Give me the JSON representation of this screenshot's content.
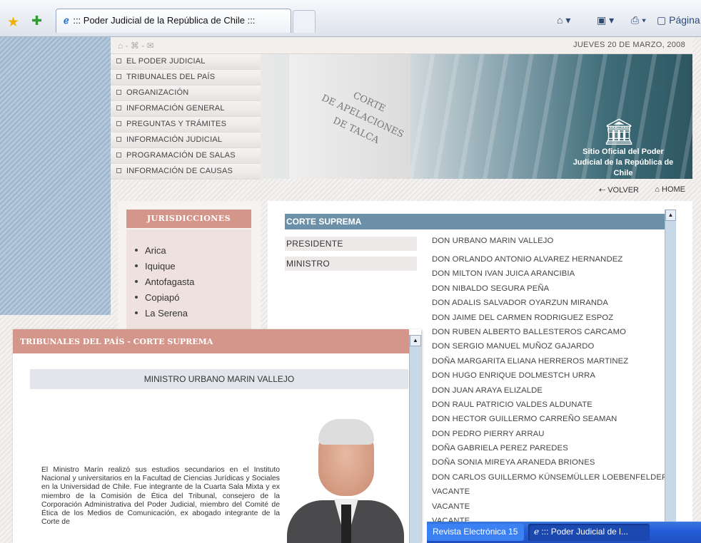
{
  "browser": {
    "tab_title": "::: Poder Judicial de la República de Chile :::",
    "tab_icon": "ie-icon",
    "toolbar_page": "Página"
  },
  "site": {
    "date": "JUEVES 20 DE MARZO, 2008",
    "menu": [
      "EL PODER JUDICIAL",
      "TRIBUNALES DEL PAÍS",
      "ORGANIZACIÓN",
      "INFORMACIÓN GENERAL",
      "PREGUNTAS Y TRÁMITES",
      "INFORMACIÓN JUDICIAL",
      "PROGRAMACIÓN DE SALAS",
      "INFORMACIÓN DE CAUSAS"
    ],
    "banner_engraving": [
      "CORTE",
      "DE APELACIONES",
      "DE TALCA"
    ],
    "banner_slogan": "Sitio Oficial del Poder Judicial de la República de Chile",
    "nav_back": "VOLVER",
    "nav_home": "HOME"
  },
  "jurisdicciones": {
    "title": "JURISDICCIONES",
    "items": [
      "Arica",
      "Iquique",
      "Antofagasta",
      "Copiapó",
      "La Serena"
    ]
  },
  "corte": {
    "title": "CORTE SUPREMA",
    "roles": [
      "PRESIDENTE",
      "MINISTRO"
    ],
    "names": [
      "DON URBANO MARIN VALLEJO",
      "DON ORLANDO ANTONIO ALVAREZ HERNANDEZ",
      "DON MILTON IVAN JUICA ARANCIBIA",
      "DON NIBALDO SEGURA PEÑA",
      "DON ADALIS SALVADOR OYARZUN MIRANDA",
      "DON JAIME DEL CARMEN RODRIGUEZ ESPOZ",
      "DON RUBEN ALBERTO BALLESTEROS CARCAMO",
      "DON SERGIO MANUEL MUÑOZ GAJARDO",
      "DOÑA MARGARITA ELIANA HERREROS MARTINEZ",
      "DON HUGO ENRIQUE DOLMESTCH URRA",
      "DON JUAN ARAYA ELIZALDE",
      "DON RAUL PATRICIO VALDES ALDUNATE",
      "DON HECTOR GUILLERMO CARREÑO SEAMAN",
      "DON PEDRO PIERRY ARRAU",
      "DOÑA GABRIELA PEREZ PAREDES",
      "DOÑA SONIA MIREYA ARANEDA BRIONES",
      "DON CARLOS GUILLERMO KÜNSEMÜLLER LOEBENFELDER",
      "VACANTE",
      "VACANTE",
      "VACANTE"
    ]
  },
  "popup": {
    "header": "TRIBUNALES DEL PAÍS - CORTE SUPREMA",
    "subtitle": "MINISTRO URBANO MARIN VALLEJO",
    "bio": "El Ministro Marín realizó sus estudios secundarios en el Instituto Nacional y universitarios en la Facultad de Ciencias Jurídicas y Sociales en la Universidad de Chile. Fue integrante de la Cuarta Sala Mixta y ex miembro de la Comisión de Ética del Tribunal, consejero de la Corporación Administrativa del Poder Judicial, miembro del Comité de Ética de los Medios de Comunicación, ex abogado integrante de la Corte de"
  },
  "taskbar": {
    "item1": "Revista Electrónica 15",
    "item2": "::: Poder Judicial de l..."
  }
}
